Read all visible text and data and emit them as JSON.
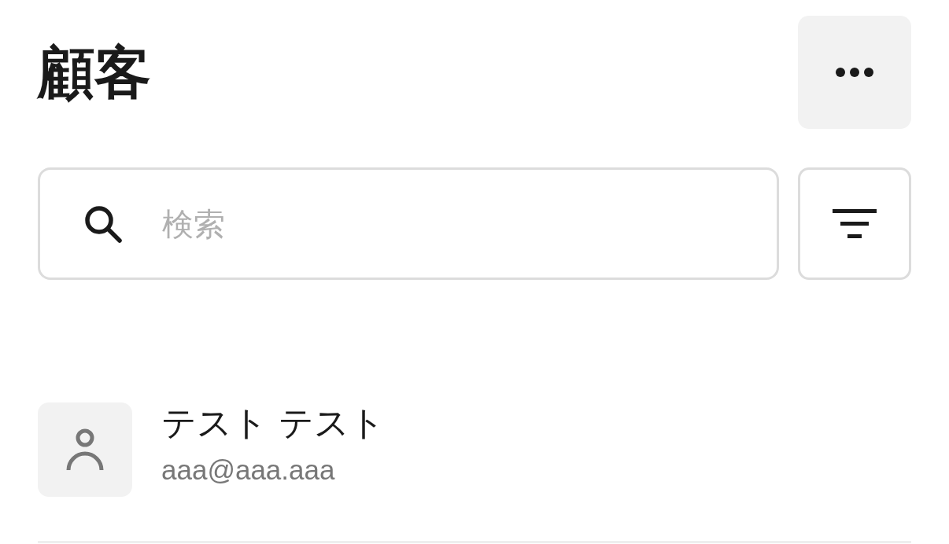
{
  "title": "顧客",
  "search": {
    "placeholder": "検索"
  },
  "customers": [
    {
      "name": "テスト テスト",
      "email": "aaa@aaa.aaa"
    }
  ]
}
